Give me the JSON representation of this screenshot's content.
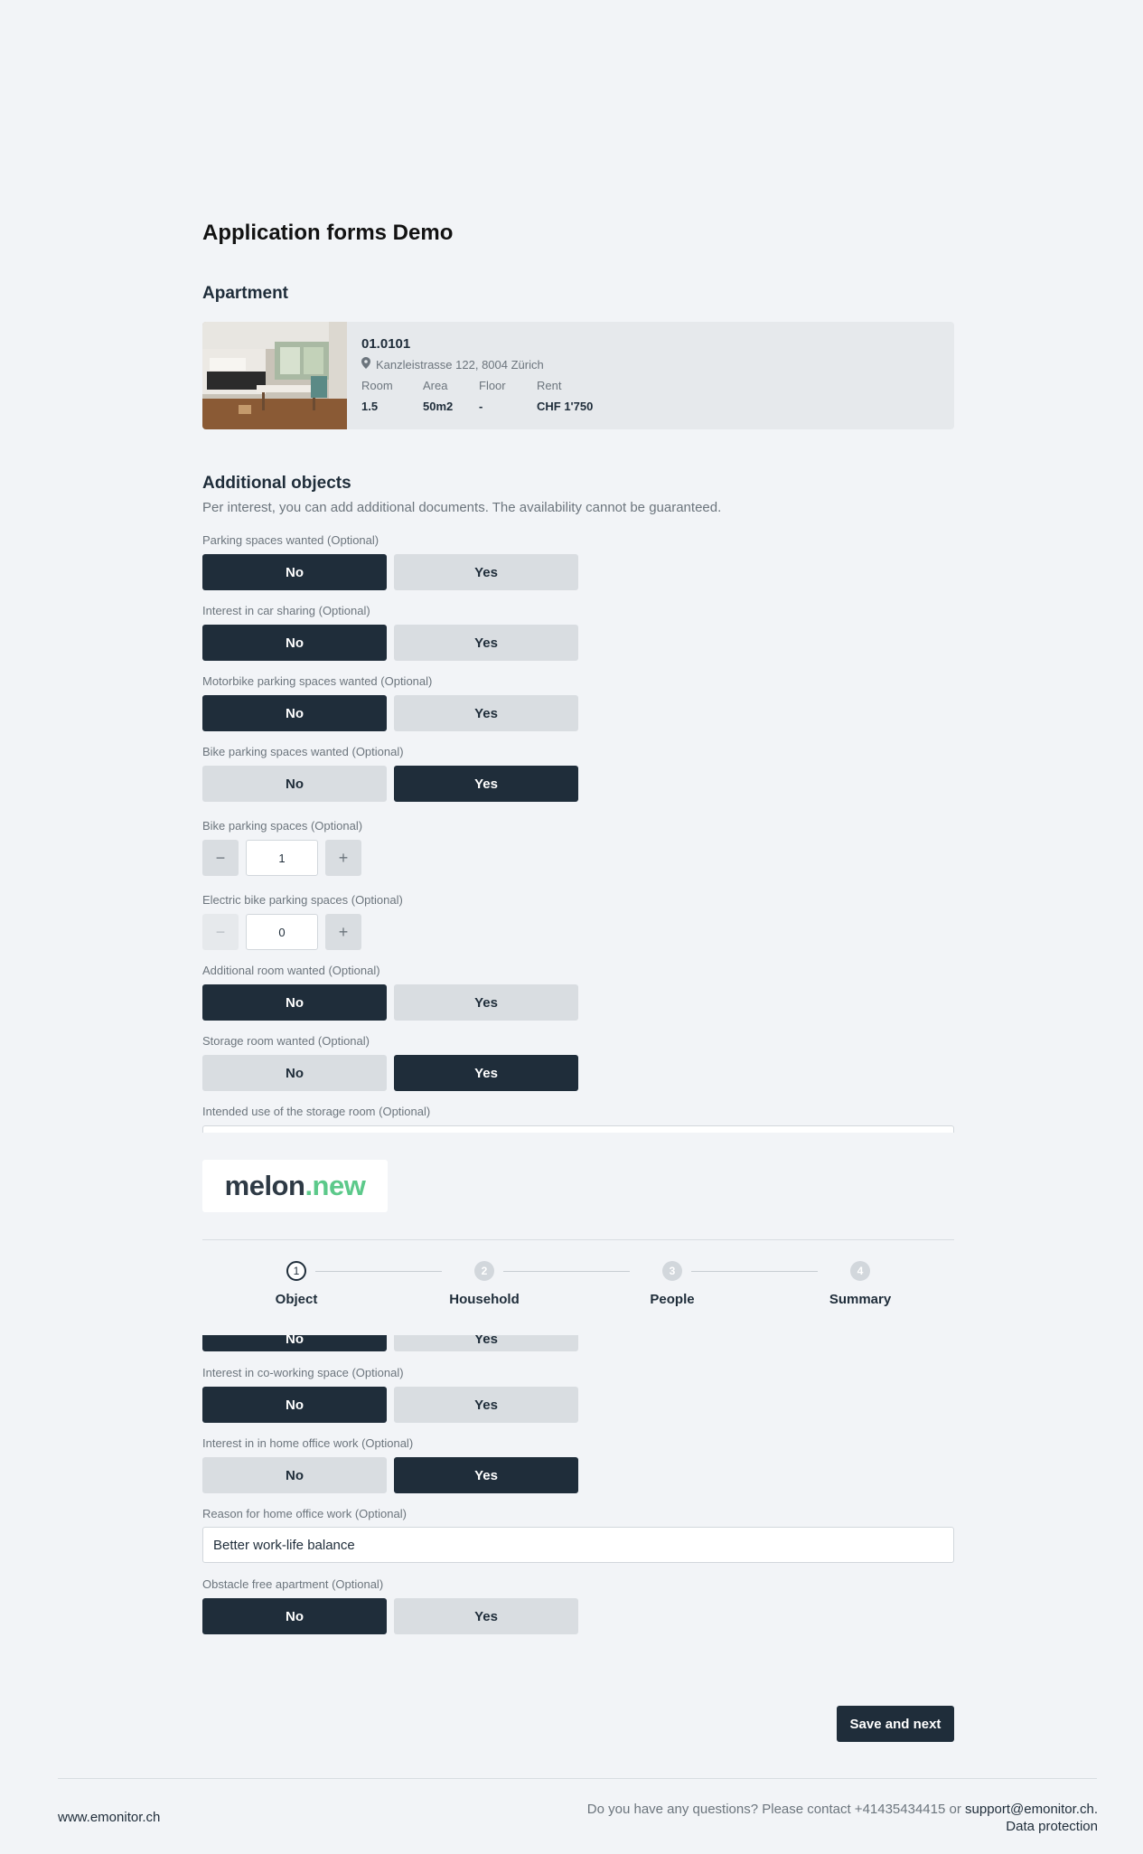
{
  "page_title": "Application forms Demo",
  "apartment": {
    "section_title": "Apartment",
    "id": "01.0101",
    "address": "Kanzleistrasse 122, 8004 Zürich",
    "labels": {
      "room": "Room",
      "area": "Area",
      "floor": "Floor",
      "rent": "Rent"
    },
    "values": {
      "room": "1.5",
      "area": "50m2",
      "floor": "-",
      "rent": "CHF 1'750"
    }
  },
  "additional": {
    "section_title": "Additional objects",
    "description": "Per interest, you can add additional documents. The availability cannot be guaranteed.",
    "no_label": "No",
    "yes_label": "Yes",
    "fields": {
      "parking": {
        "label": "Parking spaces wanted (Optional)",
        "selected": "No"
      },
      "car_sharing": {
        "label": "Interest in car sharing (Optional)",
        "selected": "No"
      },
      "motorbike": {
        "label": "Motorbike parking spaces wanted (Optional)",
        "selected": "No"
      },
      "bike": {
        "label": "Bike parking spaces wanted (Optional)",
        "selected": "Yes"
      },
      "bike_spaces": {
        "label": "Bike parking spaces (Optional)",
        "value": "1",
        "minus": "−",
        "plus": "+"
      },
      "ebike_spaces": {
        "label": "Electric bike parking spaces (Optional)",
        "value": "0",
        "minus": "−",
        "plus": "+"
      },
      "additional_room": {
        "label": "Additional room wanted (Optional)",
        "selected": "No"
      },
      "storage_room": {
        "label": "Storage room wanted (Optional)",
        "selected": "Yes"
      },
      "storage_use": {
        "label": "Intended use of the storage room (Optional)"
      },
      "peek": {
        "selected": "No"
      },
      "coworking": {
        "label": "Interest in co-working space (Optional)",
        "selected": "No"
      },
      "home_office": {
        "label": "Interest in in home office work (Optional)",
        "selected": "Yes"
      },
      "home_office_reason": {
        "label": "Reason for home office work (Optional)",
        "value": "Better work-life balance"
      },
      "obstacle_free": {
        "label": "Obstacle free apartment (Optional)",
        "selected": "No"
      }
    }
  },
  "logo": {
    "dark": "melon",
    "green": ".new"
  },
  "steps": [
    {
      "number": "1",
      "label": "Object",
      "state": "active"
    },
    {
      "number": "2",
      "label": "Household",
      "state": "inactive"
    },
    {
      "number": "3",
      "label": "People",
      "state": "inactive"
    },
    {
      "number": "4",
      "label": "Summary",
      "state": "inactive"
    }
  ],
  "save_button": "Save and next",
  "footer": {
    "site": "www.emonitor.ch",
    "question": "Do you have any questions? Please contact +41435434415 or",
    "email": "support@emonitor.ch",
    "email_suffix": ".",
    "data_protection": "Data protection"
  },
  "colors": {
    "primary": "#1f2d3a",
    "secondary": "#d9dde1",
    "background": "#f2f4f7",
    "brand_green": "#5cc98a"
  }
}
